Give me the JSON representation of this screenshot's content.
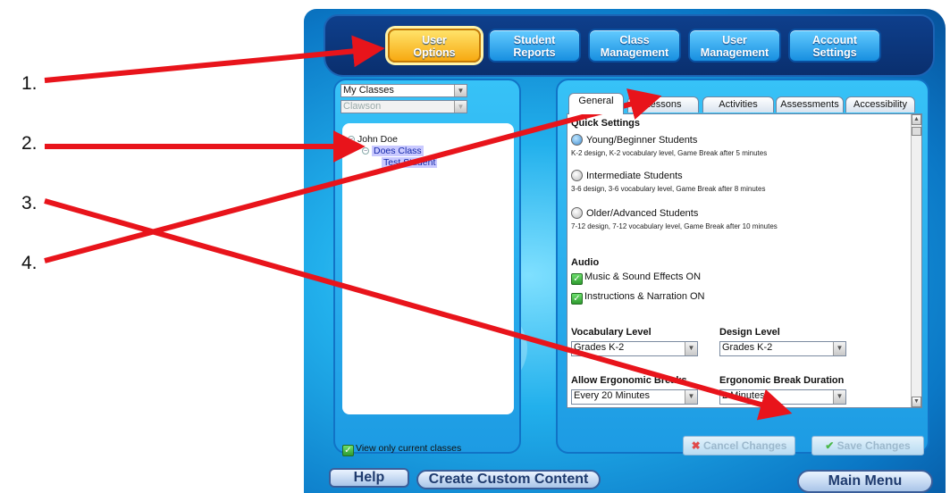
{
  "annotation_labels": [
    "1.",
    "2.",
    "3.",
    "4."
  ],
  "annotation_color": "#e8141b",
  "nav": [
    {
      "line1": "User",
      "line2": "Options",
      "active": true
    },
    {
      "line1": "Student",
      "line2": "Reports"
    },
    {
      "line1": "Class",
      "line2": "Management"
    },
    {
      "line1": "User",
      "line2": "Management"
    },
    {
      "line1": "Account",
      "line2": "Settings"
    }
  ],
  "left": {
    "class_select": "My Classes",
    "school_select": "Clawson",
    "tree": {
      "teacher": "John Doe",
      "class": "Does Class",
      "student": "Test Student"
    },
    "view_only_label": "View only current classes"
  },
  "tabs": [
    "General",
    "Lessons",
    "Activities",
    "Assessments",
    "Accessibility"
  ],
  "general": {
    "quick_settings_title": "Quick Settings",
    "presets": [
      {
        "label": "Young/Beginner Students",
        "desc": "K-2 design, K-2 vocabulary level, Game Break after 5 minutes",
        "selected": true
      },
      {
        "label": "Intermediate Students",
        "desc": "3-6 design, 3-6 vocabulary level, Game Break after 8 minutes"
      },
      {
        "label": "Older/Advanced Students",
        "desc": "7-12 design, 7-12 vocabulary level, Game Break after 10 minutes"
      }
    ],
    "audio_title": "Audio",
    "audio_options": [
      "Music & Sound Effects ON",
      "Instructions & Narration ON"
    ],
    "vocab_label": "Vocabulary Level",
    "vocab_value": "Grades K-2",
    "design_label": "Design Level",
    "design_value": "Grades K-2",
    "ergo_label": "Allow Ergonomic Breaks",
    "ergo_value": "Every 20 Minutes",
    "ergo_dur_label": "Ergonomic Break Duration",
    "ergo_dur_value": "2 Minutes"
  },
  "actions": {
    "cancel": "Cancel Changes",
    "save": "Save Changes"
  },
  "bottom": {
    "help": "Help",
    "custom": "Create Custom Content",
    "main_menu": "Main Menu"
  }
}
